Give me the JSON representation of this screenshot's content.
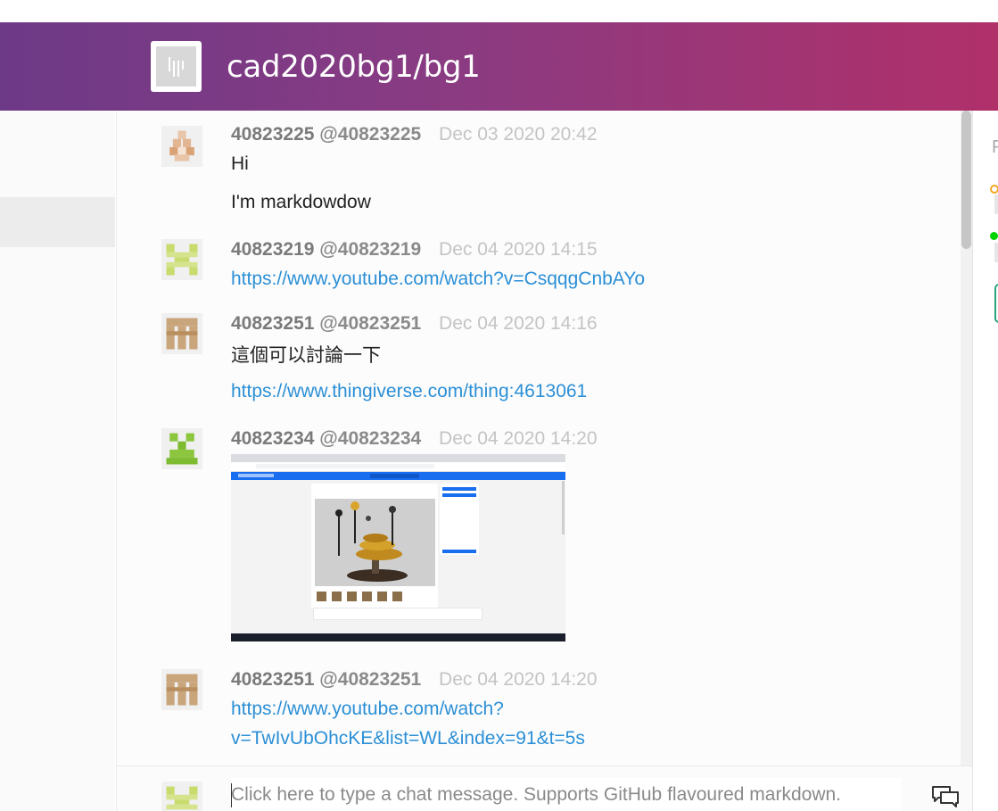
{
  "header": {
    "room_title": "cad2020bg1/bg1",
    "room_icon": "gitter-logo-icon"
  },
  "colors": {
    "header_gradient_start": "#6d3a87",
    "header_gradient_end": "#b0306a",
    "link": "#2b8fd6",
    "online_green": "#00d200",
    "away_orange": "#f5a623"
  },
  "right_panel": {
    "label_fragment": "F"
  },
  "messages": [
    {
      "avatar": "identicon-tan-diamond",
      "name": "40823225",
      "username": "@40823225",
      "time": "Dec 03 2020 20:42",
      "lines": [
        "Hi",
        "I'm markdowdow"
      ]
    },
    {
      "avatar": "identicon-lime",
      "name": "40823219",
      "username": "@40823219",
      "time": "Dec 04 2020 14:15",
      "link": "https://www.youtube.com/watch?v=CsqqgCnbAYo"
    },
    {
      "avatar": "identicon-brown",
      "name": "40823251",
      "username": "@40823251",
      "time": "Dec 04 2020 14:16",
      "text": "這個可以討論一下",
      "link": "https://www.thingiverse.com/thing:4613061"
    },
    {
      "avatar": "identicon-green",
      "name": "40823234",
      "username": "@40823234",
      "time": "Dec 04 2020 14:20",
      "image": "screenshot-thingiverse-orrery"
    },
    {
      "avatar": "identicon-brown",
      "name": "40823251",
      "username": "@40823251",
      "time": "Dec 04 2020 14:20",
      "link_line1": "https://www.youtube.com/watch?",
      "link_line2": "v=TwIvUbOhcKE&list=WL&index=91&t=5s"
    }
  ],
  "composer": {
    "placeholder": "Click here to type a chat message. Supports GitHub flavoured markdown.",
    "value": "",
    "toggle_icon": "chat-bubbles-icon"
  }
}
